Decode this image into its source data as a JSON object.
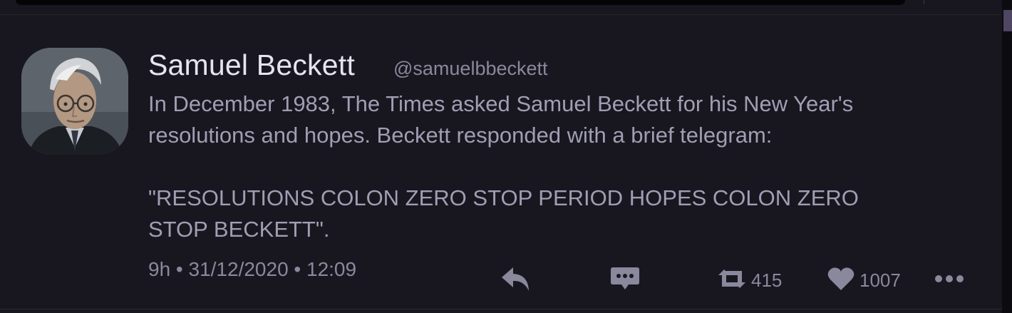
{
  "tweet": {
    "author_name": "Samuel Beckett",
    "author_handle": "@samuelbbeckett",
    "text": "In December 1983, The Times asked Samuel Beckett for his New Year's\nresolutions and hopes. Beckett responded with a brief telegram:\n\n\"RESOLUTIONS COLON ZERO STOP PERIOD HOPES COLON ZERO\nSTOP BECKETT\".",
    "timestamp": "9h • 31/12/2020 • 12:09"
  },
  "actions": {
    "reply_icon": "reply-icon",
    "dm_icon": "direct-message-icon",
    "retweet_icon": "retweet-icon",
    "retweet_count": "415",
    "like_icon": "heart-icon",
    "like_count": "1007",
    "more_icon": "more-icon"
  },
  "colors": {
    "background": "#18171f",
    "name": "#e5e4f0",
    "body_text": "#a09eb4",
    "muted": "#8a889c",
    "icon": "#8a889c"
  }
}
